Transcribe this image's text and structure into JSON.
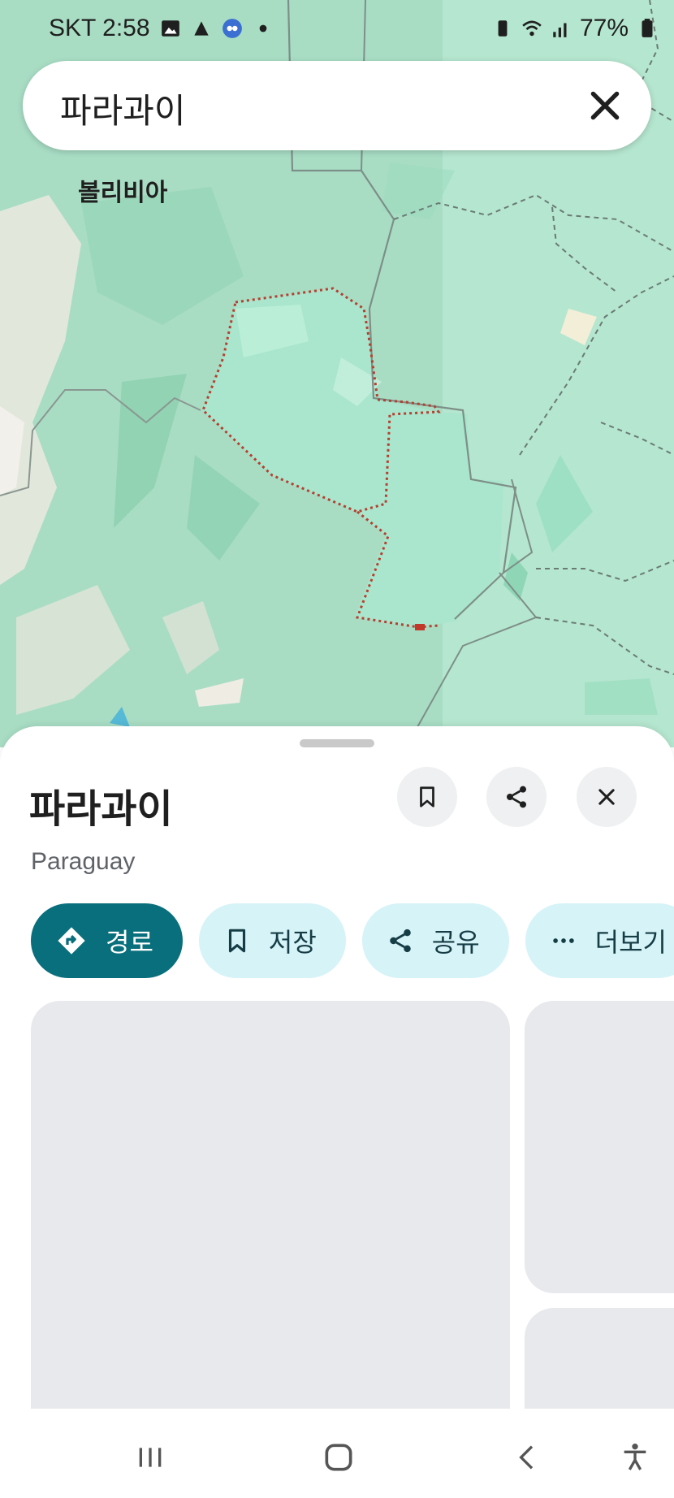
{
  "status_bar": {
    "carrier_time": "SKT 2:58",
    "battery": "77%",
    "icons": [
      "gallery-icon",
      "app-icon",
      "avatar-icon",
      "dot-icon",
      "battery-saver-icon",
      "wifi-icon",
      "signal-icon",
      "battery-icon"
    ]
  },
  "search": {
    "query": "파라과이",
    "clear_icon": "close-icon"
  },
  "map": {
    "label_bolivia": "볼리비아",
    "colors": {
      "land": "#b5e6cf",
      "highlight": "#9fdcc0",
      "border": "#7a8b84",
      "outline": "#c0392b"
    }
  },
  "place": {
    "title": "파라과이",
    "subtitle": "Paraguay",
    "header_buttons": [
      "bookmark-icon",
      "share-icon",
      "close-icon"
    ],
    "actions": [
      {
        "label": "경로",
        "icon": "directions-icon",
        "primary": true
      },
      {
        "label": "저장",
        "icon": "bookmark-icon"
      },
      {
        "label": "공유",
        "icon": "share-icon"
      },
      {
        "label": "더보기",
        "icon": "more-horiz-icon"
      }
    ]
  },
  "nav_bar": {
    "buttons": [
      "recent-apps-icon",
      "home-icon",
      "back-icon",
      "accessibility-icon"
    ]
  },
  "colors": {
    "accent": "#0a6f7c",
    "chip_bg": "#d6f3f7",
    "placeholder": "#e8e9ec"
  }
}
